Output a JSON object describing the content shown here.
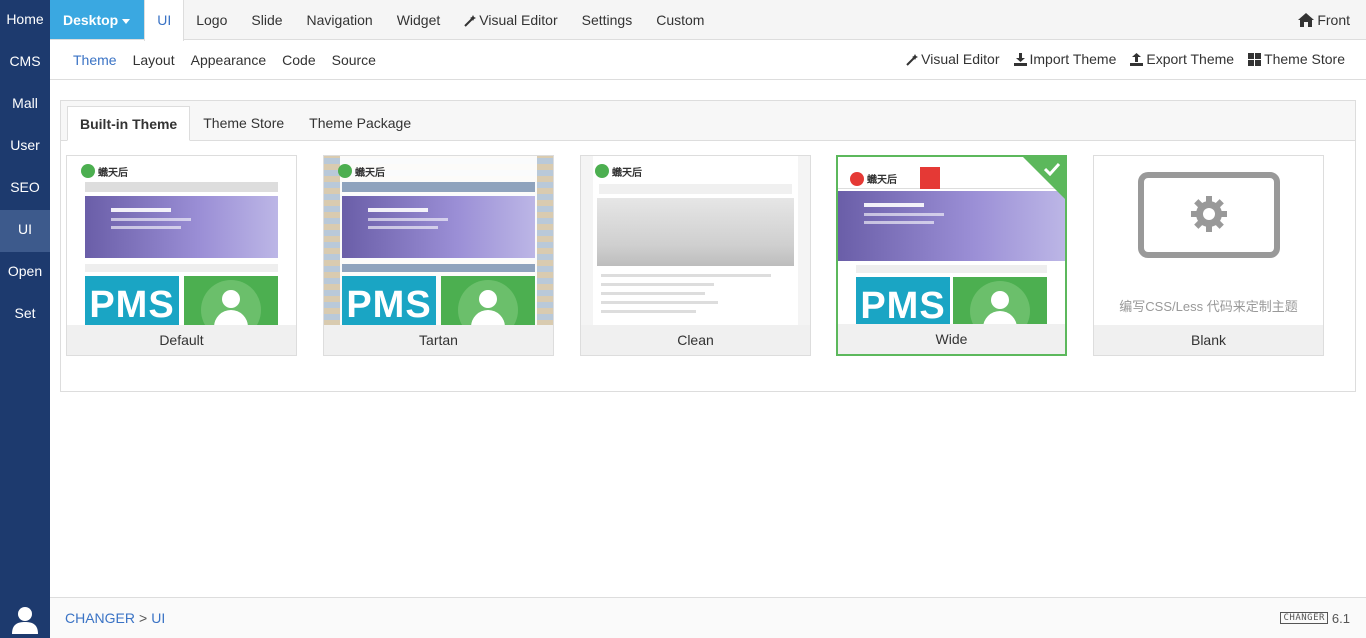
{
  "sidebar": {
    "items": [
      {
        "label": "Home"
      },
      {
        "label": "CMS"
      },
      {
        "label": "Mall"
      },
      {
        "label": "User"
      },
      {
        "label": "SEO"
      },
      {
        "label": "UI"
      },
      {
        "label": "Open"
      },
      {
        "label": "Set"
      }
    ],
    "active_index": 5,
    "user_icon": "user-icon"
  },
  "topbar": {
    "device_label": "Desktop",
    "items": [
      "UI",
      "Logo",
      "Slide",
      "Navigation",
      "Widget",
      "Visual Editor",
      "Settings",
      "Custom"
    ],
    "active": "UI",
    "front_label": "Front"
  },
  "subnav": {
    "items": [
      "Theme",
      "Layout",
      "Appearance",
      "Code",
      "Source"
    ],
    "active": "Theme",
    "actions": [
      {
        "label": "Visual Editor",
        "icon": "wand-icon"
      },
      {
        "label": "Import Theme",
        "icon": "download-icon"
      },
      {
        "label": "Export Theme",
        "icon": "upload-icon"
      },
      {
        "label": "Theme Store",
        "icon": "grid-icon"
      }
    ]
  },
  "tabs": {
    "items": [
      "Built-in Theme",
      "Theme Store",
      "Theme Package"
    ],
    "active": "Built-in Theme"
  },
  "themes": [
    {
      "label": "Default",
      "pms": "PMS"
    },
    {
      "label": "Tartan",
      "pms": "PMS"
    },
    {
      "label": "Clean"
    },
    {
      "label": "Wide",
      "pms": "PMS",
      "selected": true
    },
    {
      "label": "Blank",
      "note": "编写CSS/Less 代码来定制主题"
    }
  ],
  "footer": {
    "crumb_root": "CHANGER",
    "crumb_sep": ">",
    "crumb_current": "UI",
    "brand_tag": "CHANGER",
    "version": "6.1"
  },
  "colors": {
    "sidebar_bg": "#1d3a6e",
    "accent": "#3a73c5",
    "device_bg": "#3aa8e1",
    "selected": "#5cb85c"
  }
}
